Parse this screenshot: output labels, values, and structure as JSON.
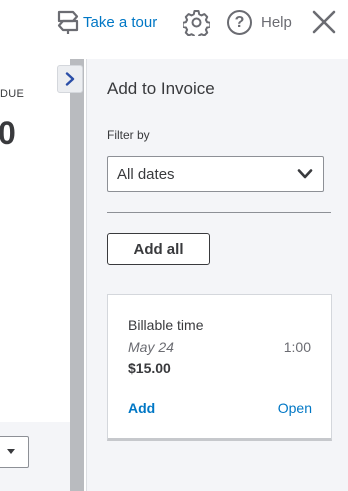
{
  "header": {
    "tour_label": "Take a tour",
    "help_label": "Help",
    "help_glyph": "?",
    "icons": {
      "tour": "signpost-icon",
      "settings": "gear-icon",
      "help": "question-circle-icon",
      "close": "close-icon"
    }
  },
  "background": {
    "due_label": "DUE",
    "due_amount": "0"
  },
  "drawer": {
    "title": "Add to Invoice",
    "filter_label": "Filter by",
    "filter_value": "All dates",
    "add_all_label": "Add all",
    "items": [
      {
        "type": "Billable time",
        "date": "May 24",
        "hours": "1:00",
        "amount": "$15.00",
        "add_label": "Add",
        "open_label": "Open"
      }
    ]
  },
  "colors": {
    "link": "#0077c5",
    "text": "#393a3d",
    "drawer_bg": "#f4f5f8",
    "scrollbar": "#b9bbbf"
  }
}
